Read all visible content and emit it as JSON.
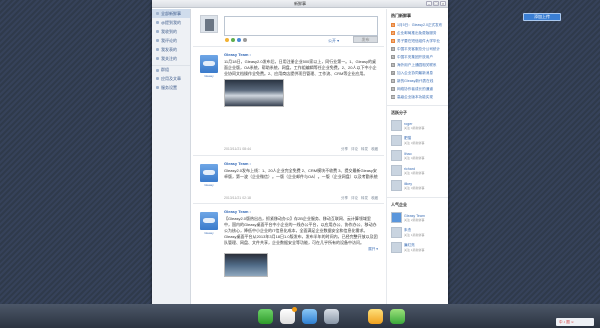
{
  "window": {
    "title": "新鲜事"
  },
  "right_button": "添加上传",
  "nav": {
    "items": [
      {
        "label": "全部新鲜事",
        "active": true
      },
      {
        "label": "@提到我的"
      },
      {
        "label": "我收到的"
      },
      {
        "label": "我评论的"
      },
      {
        "label": "我发表的"
      },
      {
        "label": "我关注的"
      },
      {
        "label": "群组"
      },
      {
        "label": "应用及文章"
      },
      {
        "label": "服务设置"
      }
    ]
  },
  "composer": {
    "scope": "公开 ▾",
    "send": "发布"
  },
  "posts": [
    {
      "author": "Gleasy Team :",
      "avatar_label": "Gleasy",
      "text": "11月18日，Gleasy2.0发布后，日用注册企业500家以上，同行业第一。1、Gleasy的桌面企业版，OA系统，帮助系统，网盘，工作组编辑等任企业免费。2、20人以下中小企业协同文档操作全免费。2、应用商店提供项目管理、工作流、CRM等企业应用。",
      "time": "2013/11/21 08:44",
      "actions": [
        "分享",
        "评论",
        "转发",
        "收藏"
      ]
    },
    {
      "author": "Gleasy Team :",
      "avatar_label": "Gleasy",
      "text": "Gleasy2.0发布上线：1、20人企业完全免费 2、CRM模块不收费 3、提交最新Gleasy安卓版，第一波（企业微信）。一版（企业邮件与OA）。一版（企业网盘）以及考勤系统",
      "time": "2013/11/21 02:18",
      "actions": [
        "分享",
        "评论",
        "转发",
        "收藏"
      ]
    },
    {
      "author": "Gleasy Team :",
      "avatar_label": "Gleasy",
      "text": "【Gleasy2.0版热出击，抓紧移动办公】存2B企业服务、移动互联网、云计算领域里中，国内的Gleasy桌面平台中小企业的一线办公平台，以应用办公、协作办公、移动办公为核心，降低中小企业的IT信息化成本，全面满足企业数据安全和信息化需求。Gleasy桌面平台从2013年3月18日1.0版发布，发布半年的时间内，已经完整开放以及团队管理、网盘、文件共享，企业数据安全等功能，可在几乎所有的设备中访问。",
      "more": "展开 ▾",
      "time": "2013/11/21 15:45",
      "actions": [
        "分享",
        "评论",
        "转发",
        "收藏"
      ]
    }
  ],
  "sidebar": {
    "topics_title": "热门新鲜事",
    "topics": [
      "1月5日：Gleasy2.0正式发布",
      "企业邮局推出免费版服务",
      "男子要在短信组件大学毕业",
      "中国平安客服总分公司统计",
      "中国平安集团开放用户",
      "海外用户上通园相关联系",
      "加入企业协同最新消息",
      "新的Gleasy新代表在线",
      "网络协作者成长的通道",
      "高级企业版本功能实现"
    ],
    "active_title": "活跃分子",
    "active": [
      {
        "name": "roger",
        "sub": "关注 4篇新鲜事"
      },
      {
        "name": "肥猫",
        "sub": "关注 3篇新鲜事"
      },
      {
        "name": "lihao",
        "sub": "关注 4篇新鲜事"
      },
      {
        "name": "richard",
        "sub": "关注 4篇新鲜事"
      },
      {
        "name": "ilikey",
        "sub": "关注 3篇新鲜事"
      }
    ],
    "popular_title": "人气企业",
    "popular": [
      {
        "name": "Gleasy Team",
        "sub": "关注 2篇新鲜事"
      },
      {
        "name": "朱杰",
        "sub": "关注 1篇新鲜事"
      },
      {
        "name": "廉红亮",
        "sub": "关注 1篇新鲜事"
      }
    ]
  },
  "tray": {
    "text": "中 ♪ 图 ☺"
  },
  "colors": {
    "accent": "#3b7fd4",
    "link": "#2d64b3"
  }
}
